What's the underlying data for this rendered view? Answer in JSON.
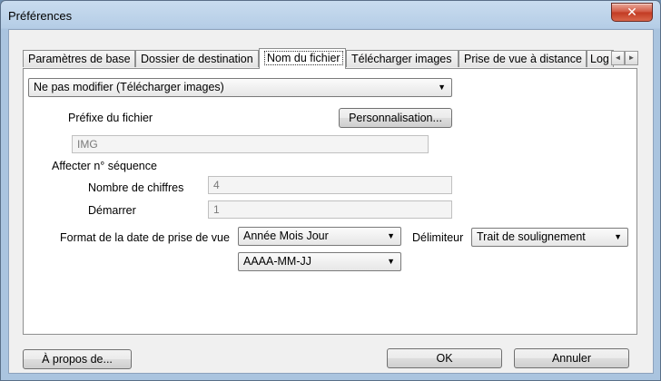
{
  "window": {
    "title": "Préférences",
    "close_glyph": "✕"
  },
  "tabs": [
    {
      "label": "Paramètres de base"
    },
    {
      "label": "Dossier de destination"
    },
    {
      "label": "Nom du fichier"
    },
    {
      "label": "Télécharger images"
    },
    {
      "label": "Prise de vue à distance"
    },
    {
      "label": "Log"
    }
  ],
  "tab_scroll": {
    "left": "◄",
    "right": "►"
  },
  "panel": {
    "mode_select": {
      "value": "Ne pas modifier (Télécharger images)"
    },
    "prefix_label": "Préfixe du fichier",
    "customize_button": "Personnalisation...",
    "prefix_value": "IMG",
    "sequence_label": "Affecter n° séquence",
    "digits_label": "Nombre de chiffres",
    "digits_value": "4",
    "start_label": "Démarrer",
    "start_value": "1",
    "date_format_label": "Format de la date de prise de vue",
    "date_order_select": {
      "value": "Année Mois Jour"
    },
    "delimiter_label": "Délimiteur",
    "delimiter_select": {
      "value": "Trait de soulignement"
    },
    "date_pattern_select": {
      "value": "AAAA-MM-JJ"
    }
  },
  "footer": {
    "about_button": "À propos de...",
    "ok_button": "OK",
    "cancel_button": "Annuler"
  },
  "icons": {
    "dropdown": "▼"
  }
}
